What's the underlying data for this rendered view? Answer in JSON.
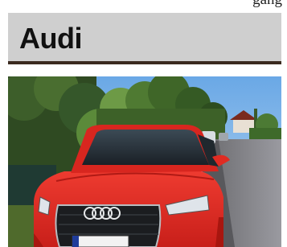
{
  "top_caption": "gang",
  "heading": {
    "title": "Audi"
  },
  "photo": {
    "subject": "red-audi-suv-photo",
    "brand_badge": "four-rings-logo"
  }
}
